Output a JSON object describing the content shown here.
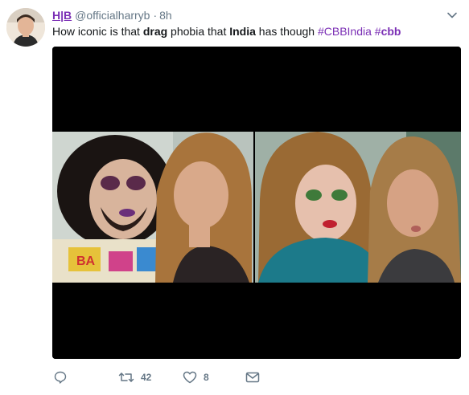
{
  "tweet": {
    "display_name": "H|B",
    "handle": "@officialharryb",
    "separator": "·",
    "time": "8h",
    "text": {
      "part1": "How iconic is that ",
      "bold1": "drag",
      "part2": " phobia that ",
      "bold2": "India",
      "part3": " has though ",
      "hashtag1": "#CBBIndia",
      "hashtag2_prefix": "#",
      "hashtag2_bold": "cbb"
    },
    "media": {
      "alt": "Two selfies of a woman posing with people in drag makeup",
      "letterbox_color": "#000000"
    },
    "actions": {
      "reply_icon": "reply-icon",
      "retweet_count": "42",
      "like_count": "8",
      "dm_icon": "envelope-icon"
    }
  },
  "colors": {
    "accent": "#7b2fb5",
    "muted": "#657786",
    "text": "#14171a"
  }
}
